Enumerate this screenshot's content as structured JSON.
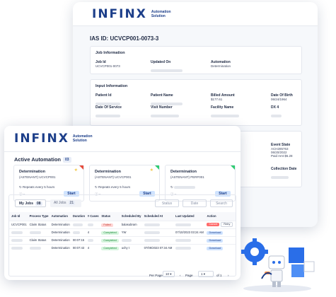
{
  "back": {
    "logo": "INFINX",
    "logo_sub_line1": "Automation",
    "logo_sub_line2": "Solution",
    "ias_title": "IAS ID: UCVCP001-0073-3",
    "job_info": {
      "title": "Job Information",
      "fields": [
        {
          "label": "Job Id",
          "value": "UCVCP001-0073"
        },
        {
          "label": "Updated On",
          "value": ""
        },
        {
          "label": "Automation",
          "value": "Determination"
        }
      ]
    },
    "input_info": {
      "title": "Input Information",
      "fields": [
        {
          "label": "Patient Id",
          "value": ""
        },
        {
          "label": "Patient Name",
          "value": ""
        },
        {
          "label": "Billed Amount",
          "value": "$177.61"
        },
        {
          "label": "Date Of Birth",
          "value": "06/24/1964"
        },
        {
          "label": "Date Of Service",
          "value": ""
        },
        {
          "label": "Visit Number",
          "value": ""
        },
        {
          "label": "Facility Name",
          "value": ""
        },
        {
          "label": "DX 4",
          "value": ""
        }
      ]
    },
    "event": {
      "event_state_label": "Event State",
      "event_state_values": [
        "ACH285763",
        "06/20/2022",
        "Paid Amt $5.28"
      ],
      "collection_date_label": "Collection Date"
    }
  },
  "front": {
    "logo": "INFINX",
    "logo_sub_line1": "Automation",
    "logo_sub_line2": "Solution",
    "active_title": "Active Automation",
    "active_count": "03",
    "cards": [
      {
        "name": "Determination",
        "tenant": "(ASTENANT) UCVCP001",
        "repeat": "Repeats every 5 hours",
        "start": "Start",
        "accent": "#f2c94c",
        "corner": "#e74c3c"
      },
      {
        "name": "Determination",
        "tenant": "(ASTENANT) UCVCP001",
        "repeat": "Repeats every 5 hours",
        "start": "Start",
        "accent": "#f2c94c",
        "corner": "#2ecc71"
      },
      {
        "name": "Determination",
        "tenant": "(ASTENANT) PERF001",
        "repeat": "",
        "start": "Start",
        "accent": "",
        "corner": "#2ecc71"
      }
    ],
    "tabs": {
      "my_jobs": "My Jobs",
      "my_jobs_count": "08",
      "all_jobs": "All Jobs",
      "all_jobs_count": "21"
    },
    "controls": {
      "status": "Status",
      "date": "Date",
      "search": "Search"
    },
    "table": {
      "headers": [
        "Job Id",
        "Process Type",
        "Automation",
        "Duration",
        "# Cases",
        "Status",
        "Scheduled By",
        "Scheduled At",
        "Last Updated",
        "Action"
      ],
      "rows": [
        {
          "job": "UCVCP001",
          "process": "Claim Status",
          "automation": "Determination",
          "duration": "",
          "cases": "",
          "status": "Failed",
          "status_kind": "failed",
          "by": "balasubram",
          "at": "",
          "updated": "",
          "actions": [
            "Cancel",
            "Retry"
          ]
        },
        {
          "job": "",
          "process": "",
          "automation": "Determination",
          "duration": "",
          "cases": "4",
          "status": "Completed",
          "status_kind": "completed",
          "by": "YW",
          "at": "",
          "updated": "07/10/2023 03:24 AM",
          "actions": [
            "Download"
          ]
        },
        {
          "job": "",
          "process": "Claim Status",
          "automation": "Determination",
          "duration": "00:07:15",
          "cases": "",
          "status": "Completed",
          "status_kind": "completed",
          "by": "",
          "at": "",
          "updated": "",
          "actions": [
            "Download"
          ]
        },
        {
          "job": "",
          "process": "",
          "automation": "Determination",
          "duration": "00:07:43",
          "cases": "4",
          "status": "Completed",
          "status_kind": "completed",
          "by": "uchy t",
          "at": "07/09/2023 07:34 AM",
          "updated": "",
          "actions": [
            "Download"
          ]
        }
      ]
    },
    "pager": {
      "per_page_label": "Per Page",
      "per_page": "10",
      "page_label": "Page",
      "page": "1",
      "of_label": "of 1"
    }
  }
}
